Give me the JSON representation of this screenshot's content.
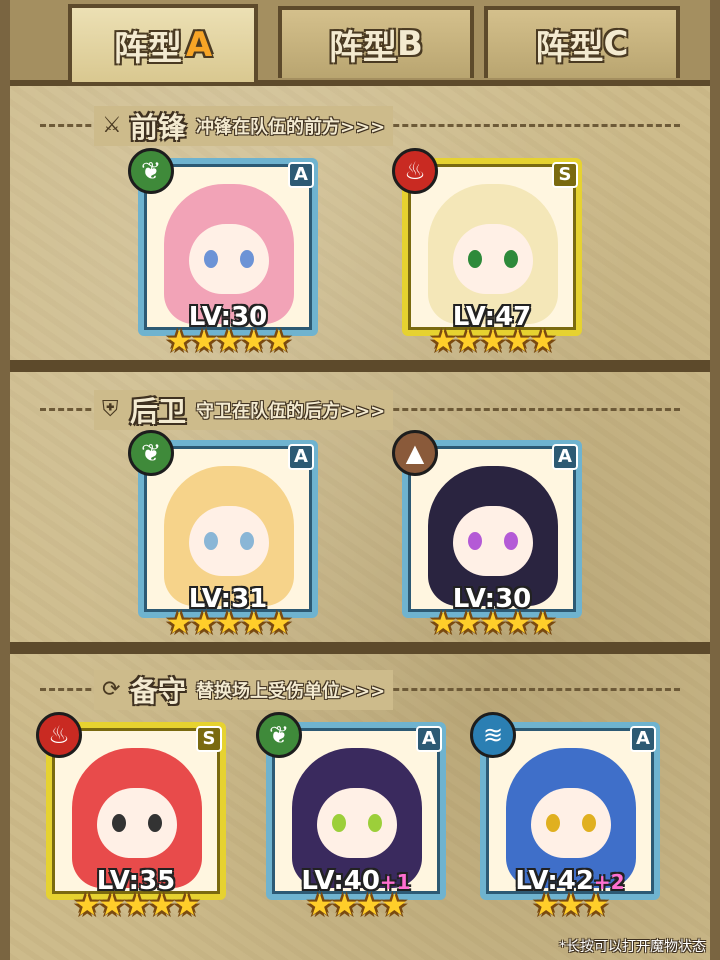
{
  "tabs": [
    {
      "label": "阵型",
      "letter": "A",
      "active": true
    },
    {
      "label": "阵型",
      "letter": "B",
      "active": false
    },
    {
      "label": "阵型",
      "letter": "C",
      "active": false
    }
  ],
  "sections": {
    "front": {
      "icon": "sword-icon",
      "name": "前锋",
      "desc": "冲锋在队伍的前方>>>"
    },
    "rear": {
      "icon": "shield-icon",
      "name": "后卫",
      "desc": "守卫在队伍的后方>>>"
    },
    "reserve": {
      "icon": "swap-icon",
      "name": "备守",
      "desc": "替换场上受伤单位>>>"
    }
  },
  "front_cards": [
    {
      "element": "nature",
      "rank": "A",
      "level": "LV:30",
      "plus": "",
      "stars": "★★★★★",
      "hair": "#f2a3b7",
      "eyes": "#6c93d6"
    },
    {
      "element": "fire",
      "rank": "S",
      "level": "LV:47",
      "plus": "",
      "stars": "★★★★★",
      "hair": "#f4e7b8",
      "eyes": "#2e8a3a"
    }
  ],
  "rear_cards": [
    {
      "element": "nature",
      "rank": "A",
      "level": "LV:31",
      "plus": "",
      "stars": "★★★★★",
      "hair": "#f6d38a",
      "eyes": "#8ab6d6"
    },
    {
      "element": "earth",
      "rank": "A",
      "level": "LV:30",
      "plus": "",
      "stars": "★★★★★",
      "hair": "#2a2440",
      "eyes": "#b45ad6"
    }
  ],
  "reserve_cards": [
    {
      "element": "fire",
      "rank": "S",
      "level": "LV:35",
      "plus": "",
      "stars": "★★★★★",
      "hair": "#e84b4b",
      "eyes": "#333333"
    },
    {
      "element": "nature",
      "rank": "A",
      "level": "LV:40",
      "plus": "+1",
      "stars": "★★★★",
      "hair": "#3a2a5e",
      "eyes": "#9ccf3a"
    },
    {
      "element": "water",
      "rank": "A",
      "level": "LV:42",
      "plus": "+2",
      "stars": "★★★",
      "hair": "#3f6fc9",
      "eyes": "#e0b020"
    }
  ],
  "element_glyphs": {
    "nature": "❦",
    "fire": "♨",
    "earth": "▲",
    "water": "≋"
  },
  "footer_note": "*长按可以打开魔物状态"
}
